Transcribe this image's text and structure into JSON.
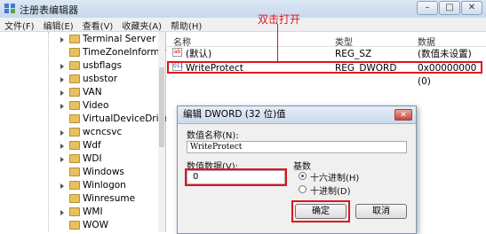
{
  "window": {
    "title": "注册表编辑器",
    "minimize": "–",
    "maximize": "□",
    "close": "✕"
  },
  "menu": [
    "文件(F)",
    "编辑(E)",
    "查看(V)",
    "收藏夹(A)",
    "帮助(H)"
  ],
  "tree": {
    "items": [
      {
        "label": "Terminal Server",
        "expandable": true
      },
      {
        "label": "TimeZoneInformat",
        "expandable": false
      },
      {
        "label": "usbflags",
        "expandable": true
      },
      {
        "label": "usbstor",
        "expandable": true
      },
      {
        "label": "VAN",
        "expandable": true
      },
      {
        "label": "Video",
        "expandable": true
      },
      {
        "label": "VirtualDeviceDriver",
        "expandable": false
      },
      {
        "label": "wcncsvc",
        "expandable": true
      },
      {
        "label": "Wdf",
        "expandable": true
      },
      {
        "label": "WDI",
        "expandable": true
      },
      {
        "label": "Windows",
        "expandable": false
      },
      {
        "label": "Winlogon",
        "expandable": true
      },
      {
        "label": "Winresume",
        "expandable": false
      },
      {
        "label": "WMI",
        "expandable": true
      },
      {
        "label": "WOW",
        "expandable": false
      }
    ]
  },
  "list": {
    "columns": {
      "name": "名称",
      "type": "类型",
      "data": "数据"
    },
    "rows": [
      {
        "name": "(默认)",
        "type": "REG_SZ",
        "data": "(数值未设置)",
        "icon": "ab"
      },
      {
        "name": "WriteProtect",
        "type": "REG_DWORD",
        "data": "0x00000000 (0)",
        "icon": "011"
      }
    ]
  },
  "annotation": {
    "text": "双击打开"
  },
  "dialog": {
    "title": "编辑 DWORD (32 位)值",
    "close": "✕",
    "name_label": "数值名称(N):",
    "name_value": "WriteProtect",
    "data_label": "数值数据(V):",
    "data_value": "0",
    "base_label": "基数",
    "base_options": [
      "十六进制(H)",
      "十进制(D)"
    ],
    "selected_base": "十六进制(H)",
    "ok": "确定",
    "cancel": "取消"
  },
  "colors": {
    "highlight": "#e0141f",
    "folder": "#e8c15e"
  }
}
